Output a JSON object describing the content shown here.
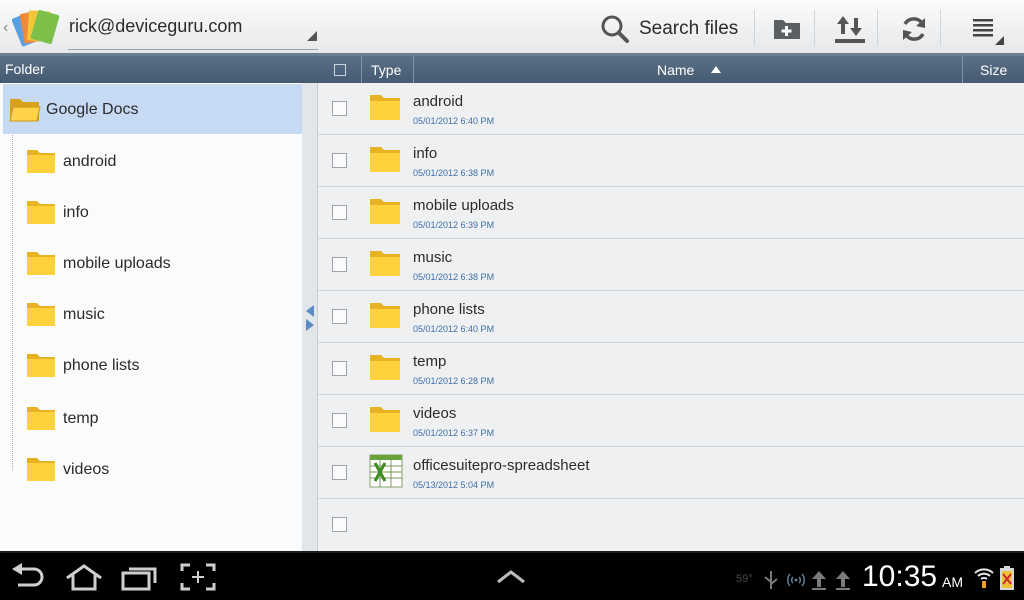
{
  "topbar": {
    "app_logo_icon": "stacked-cards-logo-icon",
    "account": "rick@deviceguru.com",
    "search_label": "Search files",
    "actions": [
      "new-folder-icon",
      "upload-download-icon",
      "refresh-icon",
      "menu-icon"
    ]
  },
  "folder_panel": {
    "header": "Folder",
    "root": "Google Docs",
    "items": [
      "android",
      "info",
      "mobile uploads",
      "music",
      "phone lists",
      "temp",
      "videos"
    ]
  },
  "file_list": {
    "headers": {
      "type": "Type",
      "name": "Name",
      "size": "Size"
    },
    "sort": "ascending",
    "rows": [
      {
        "name": "android",
        "date": "05/01/2012 6:40 PM",
        "icon": "folder"
      },
      {
        "name": "info",
        "date": "05/01/2012 6:38 PM",
        "icon": "folder"
      },
      {
        "name": "mobile uploads",
        "date": "05/01/2012 6:39 PM",
        "icon": "folder"
      },
      {
        "name": "music",
        "date": "05/01/2012 6:38 PM",
        "icon": "folder"
      },
      {
        "name": "phone lists",
        "date": "05/01/2012 6:40 PM",
        "icon": "folder"
      },
      {
        "name": "temp",
        "date": "05/01/2012 6:28 PM",
        "icon": "folder"
      },
      {
        "name": "videos",
        "date": "05/01/2012 6:37 PM",
        "icon": "folder"
      },
      {
        "name": "officesuitepro-spreadsheet",
        "date": "05/13/2012 5:04 PM",
        "icon": "spreadsheet"
      }
    ]
  },
  "system_bar": {
    "temperature": "59°",
    "time": "10:35",
    "ampm": "AM",
    "colors": {
      "accent_blue": "#3f6fa5",
      "selection": "#c7daf3",
      "header": "#4f657c",
      "folder": "#f4c430"
    }
  }
}
